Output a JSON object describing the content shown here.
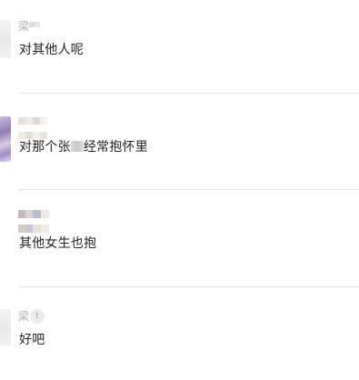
{
  "messages": [
    {
      "sender": "梁",
      "text": "对其他人呢"
    },
    {
      "sender": "",
      "text_before": "对那个张",
      "text_after": "经常抱怀里"
    },
    {
      "sender": "",
      "text": "其他女生也抱"
    },
    {
      "sender": "梁",
      "sender_badge": "t",
      "text": "好吧"
    }
  ],
  "colors": {
    "name": "#b0b0b0",
    "text": "#222222",
    "divider": "#e6e6e6",
    "background": "#ffffff"
  }
}
